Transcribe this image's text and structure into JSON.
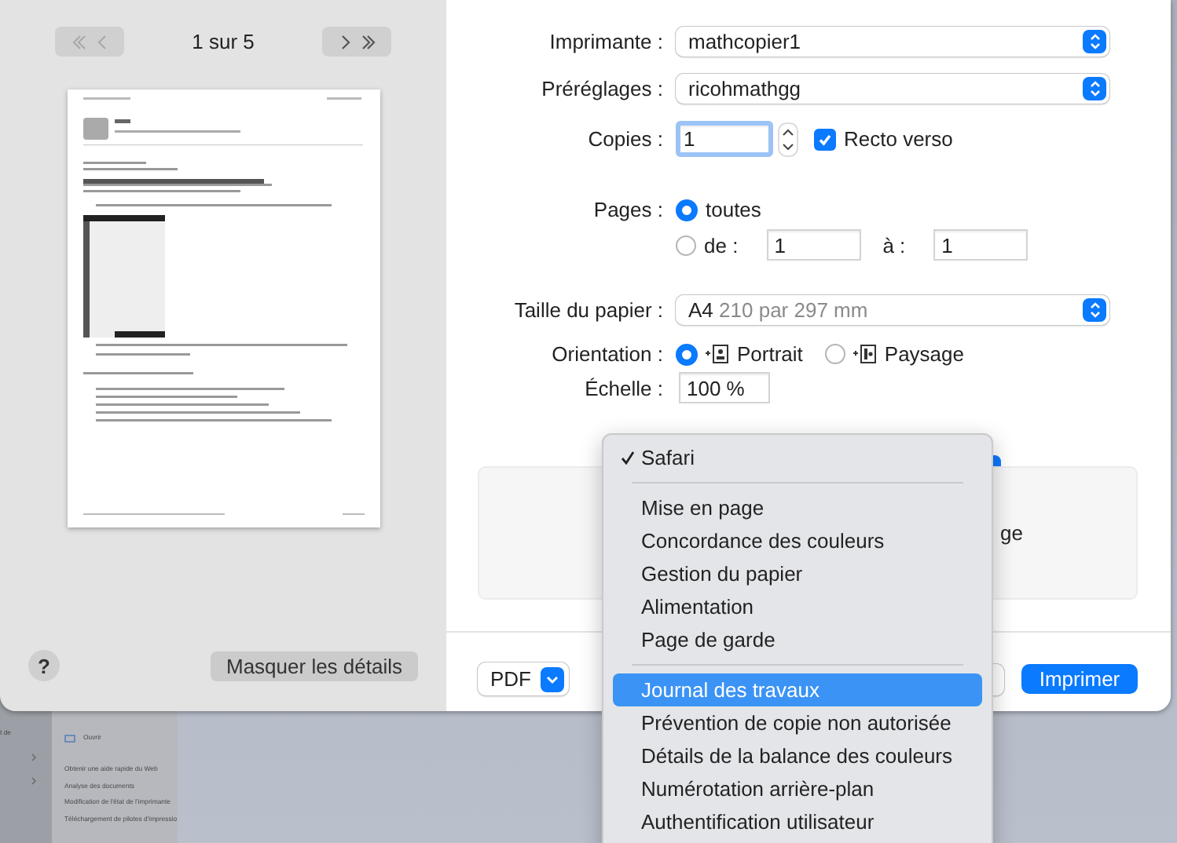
{
  "background_window": {
    "side_label": "t de",
    "open_item": "Ouvrir",
    "items": [
      "Obtenir une aide rapide du Web",
      "Analyse des documents",
      "Modification de l'état de l'imprimante",
      "Téléchargement de pilotes d'impressio"
    ]
  },
  "preview": {
    "back_disabled": true,
    "forward_disabled": false,
    "page_counter": "1 sur 5"
  },
  "help_button": "?",
  "details_button": "Masquer les détails",
  "form": {
    "printer": {
      "label": "Imprimante :",
      "value": "mathcopier1"
    },
    "presets": {
      "label": "Préréglages :",
      "value": "ricohmathgg"
    },
    "copies": {
      "label": "Copies :",
      "value": "1"
    },
    "duplex": {
      "label": "Recto verso",
      "checked": true
    },
    "pages": {
      "label": "Pages :",
      "options": [
        {
          "label": "toutes",
          "selected": true
        },
        {
          "label": "de :",
          "selected": false
        }
      ],
      "from": "1",
      "to_label": "à :",
      "to": "1"
    },
    "paper": {
      "label": "Taille du papier :",
      "value": "A4",
      "detail": "210 par 297 mm"
    },
    "orientation": {
      "label": "Orientation :",
      "options": [
        {
          "kind": "portrait",
          "label": "Portrait",
          "selected": true
        },
        {
          "kind": "landscape",
          "label": "Paysage",
          "selected": false
        }
      ]
    },
    "scale": {
      "label": "Échelle :",
      "value": "100 %"
    }
  },
  "section_panel": {
    "text": "ge"
  },
  "footer": {
    "pdf": "PDF",
    "print": "Imprimer"
  },
  "menu": {
    "items": [
      {
        "kind": "item",
        "label": "Safari",
        "checked": true,
        "selected": false
      },
      {
        "kind": "separator"
      },
      {
        "kind": "item",
        "label": "Mise en page",
        "checked": false,
        "selected": false
      },
      {
        "kind": "item",
        "label": "Concordance des couleurs",
        "checked": false,
        "selected": false
      },
      {
        "kind": "item",
        "label": "Gestion du papier",
        "checked": false,
        "selected": false
      },
      {
        "kind": "item",
        "label": "Alimentation",
        "checked": false,
        "selected": false
      },
      {
        "kind": "item",
        "label": "Page de garde",
        "checked": false,
        "selected": false
      },
      {
        "kind": "separator"
      },
      {
        "kind": "item",
        "label": "Journal des travaux",
        "checked": false,
        "selected": true
      },
      {
        "kind": "item",
        "label": "Prévention de copie non autorisée",
        "checked": false,
        "selected": false
      },
      {
        "kind": "item",
        "label": "Détails de la balance des couleurs",
        "checked": false,
        "selected": false
      },
      {
        "kind": "item",
        "label": "Numérotation arrière-plan",
        "checked": false,
        "selected": false
      },
      {
        "kind": "item",
        "label": "Authentification utilisateur",
        "checked": false,
        "selected": false
      }
    ]
  }
}
